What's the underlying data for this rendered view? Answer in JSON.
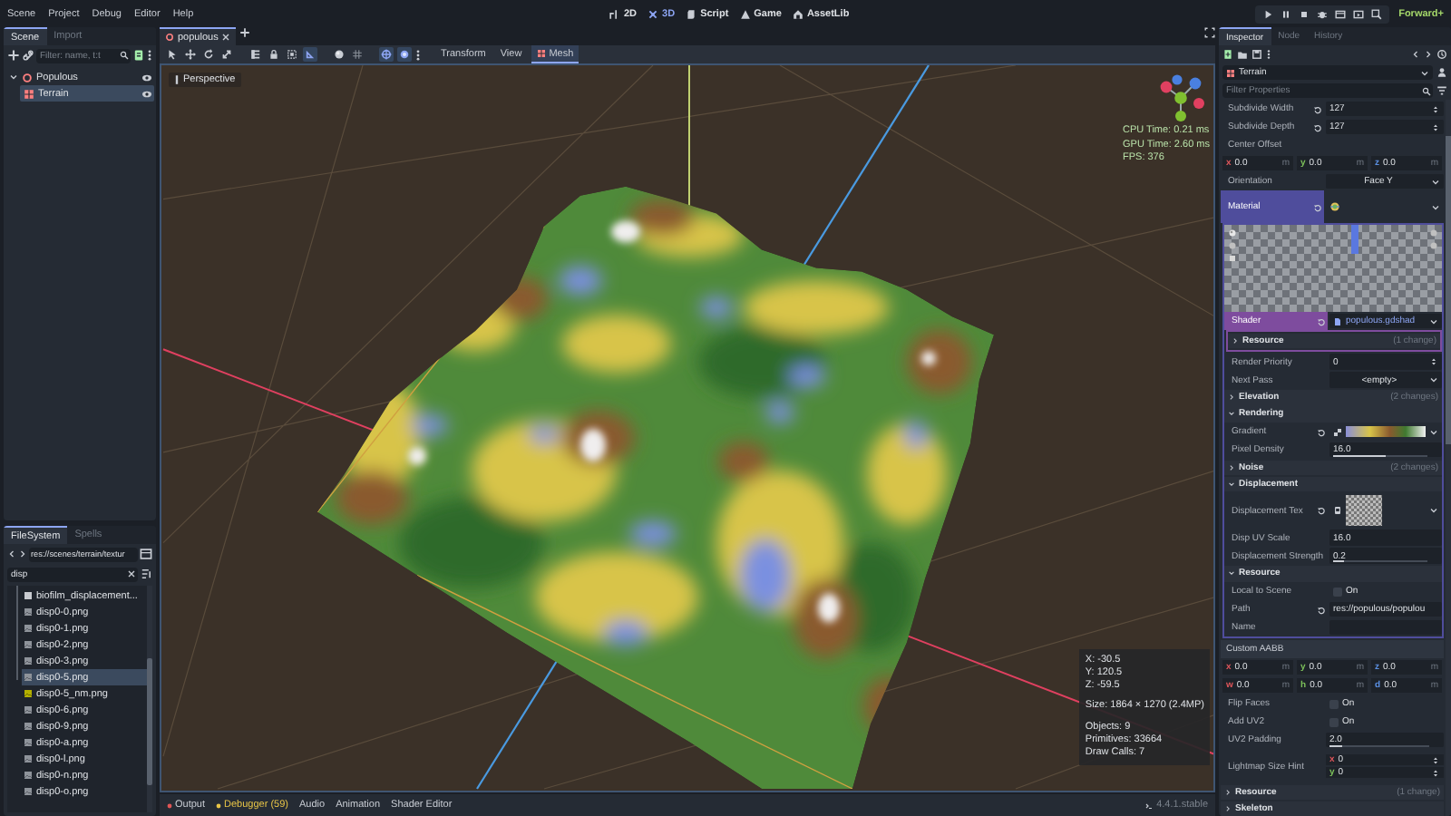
{
  "menu": [
    "Scene",
    "Project",
    "Debug",
    "Editor",
    "Help"
  ],
  "workspaces": [
    {
      "kind": "flat",
      "label": "2D",
      "selected": false
    },
    {
      "kind": "spatial",
      "label": "3D",
      "selected": true
    },
    {
      "kind": "script",
      "label": "Script",
      "selected": false
    },
    {
      "kind": "game",
      "label": "Game",
      "selected": false
    },
    {
      "kind": "assetlib",
      "label": "AssetLib",
      "selected": false
    }
  ],
  "renderer": "Forward+",
  "scene_dock": {
    "tabs": [
      {
        "label": "Scene",
        "selected": true
      },
      {
        "label": "Import",
        "selected": false
      }
    ],
    "filter": {
      "placeholder": "Filter: name, t:t"
    },
    "tree": [
      {
        "label": "Populous",
        "kind": "node3d",
        "selected": false,
        "expanded": true,
        "children": [
          {
            "label": "Terrain",
            "kind": "mesh",
            "selected": true
          }
        ]
      }
    ]
  },
  "filesystem": {
    "tabs": [
      {
        "label": "FileSystem",
        "selected": true
      },
      {
        "label": "Spells",
        "selected": false
      }
    ],
    "path": "res://scenes/terrain/textur",
    "search": {
      "value": "disp"
    },
    "files": [
      {
        "label": "biofilm_displacement...",
        "kind": "plain",
        "selected": false
      },
      {
        "label": "disp0-0.png",
        "kind": "image",
        "selected": false
      },
      {
        "label": "disp0-1.png",
        "kind": "image",
        "selected": false
      },
      {
        "label": "disp0-2.png",
        "kind": "image",
        "selected": false
      },
      {
        "label": "disp0-3.png",
        "kind": "image",
        "selected": false
      },
      {
        "label": "disp0-5.png",
        "kind": "image",
        "selected": true
      },
      {
        "label": "disp0-5_nm.png",
        "kind": "normal",
        "selected": false
      },
      {
        "label": "disp0-6.png",
        "kind": "image",
        "selected": false
      },
      {
        "label": "disp0-9.png",
        "kind": "image",
        "selected": false
      },
      {
        "label": "disp0-a.png",
        "kind": "image",
        "selected": false
      },
      {
        "label": "disp0-l.png",
        "kind": "image",
        "selected": false
      },
      {
        "label": "disp0-n.png",
        "kind": "image",
        "selected": false
      },
      {
        "label": "disp0-o.png",
        "kind": "image",
        "selected": false
      }
    ]
  },
  "editor_tabs": [
    {
      "label": "populous",
      "selected": true
    }
  ],
  "viewport_toolbar": {
    "tools": [
      {
        "kind": "select",
        "selected": false
      },
      {
        "kind": "move",
        "selected": false
      },
      {
        "kind": "rotate",
        "selected": false
      },
      {
        "kind": "scale",
        "selected": false
      },
      {
        "kind": "list",
        "selected": false
      },
      {
        "kind": "lock",
        "selected": false
      },
      {
        "kind": "group",
        "selected": false
      },
      {
        "kind": "ruler",
        "selected": true
      },
      {
        "kind": "sphere",
        "selected": false
      },
      {
        "kind": "grid",
        "selected": false
      },
      {
        "kind": "snap",
        "selected": true
      },
      {
        "kind": "sun",
        "selected": true
      }
    ],
    "menus": [
      {
        "label": "Transform",
        "selected": false
      },
      {
        "label": "View",
        "selected": false
      },
      {
        "label": "Mesh",
        "selected": true
      }
    ]
  },
  "viewport": {
    "camera": "Perspective",
    "stats": [
      "CPU Time: 0.21 ms",
      "GPU Time: 2.60 ms",
      "FPS: 376"
    ],
    "info": [
      [
        "X: -30.5",
        "Y: 120.5",
        "Z: -59.5"
      ],
      [
        "Size: 1864 × 1270 (2.4MP)"
      ],
      [
        "Objects: 9",
        "Primitives: 33664",
        "Draw Calls: 7"
      ]
    ]
  },
  "bottom_panel": {
    "tabs": [
      {
        "label": "Output",
        "color": "#e05555"
      },
      {
        "label": "Debugger (59)",
        "color": "#e8c547"
      },
      {
        "label": "Audio"
      },
      {
        "label": "Animation"
      },
      {
        "label": "Shader Editor"
      }
    ],
    "version": "4.4.1.stable"
  },
  "inspector": {
    "tabs": [
      {
        "label": "Inspector",
        "selected": true
      },
      {
        "label": "Node",
        "selected": false
      },
      {
        "label": "History",
        "selected": false
      }
    ],
    "object": "Terrain",
    "filter": {
      "placeholder": "Filter Properties"
    },
    "properties": [
      {
        "kind": "spin",
        "label": "Subdivide Width",
        "value": "127",
        "revert": true
      },
      {
        "kind": "spin",
        "label": "Subdivide Depth",
        "value": "127",
        "revert": true
      },
      {
        "kind": "label",
        "label": "Center Offset"
      },
      {
        "kind": "vector",
        "fields": [
          {
            "axis": "x",
            "value": "0.0",
            "unit": "m"
          },
          {
            "axis": "y",
            "value": "0.0",
            "unit": "m"
          },
          {
            "axis": "z",
            "value": "0.0",
            "unit": "m"
          }
        ]
      },
      {
        "kind": "enum",
        "label": "Orientation",
        "value": "Face Y"
      },
      {
        "kind": "resource",
        "label": "Material",
        "revert": true,
        "color": "#4f4d9c",
        "children": [
          {
            "kind": "preview"
          },
          {
            "kind": "resource",
            "label": "Shader",
            "value": "populous.gdshad",
            "revert": true,
            "color": "#7e4c9e",
            "children": [
              {
                "kind": "section",
                "label": "Resource",
                "note": "(1 change)",
                "expanded": false
              }
            ]
          },
          {
            "kind": "spin",
            "label": "Render Priority",
            "value": "0"
          },
          {
            "kind": "enum",
            "label": "Next Pass",
            "value": "<empty>"
          },
          {
            "kind": "section",
            "label": "Elevation",
            "note": "(2 changes)",
            "expanded": false
          },
          {
            "kind": "section",
            "label": "Rendering",
            "expanded": true
          },
          {
            "kind": "gradient",
            "label": "Gradient",
            "revert": true
          },
          {
            "kind": "slider",
            "label": "Pixel Density",
            "value": "16.0",
            "level": 0.55
          },
          {
            "kind": "section",
            "label": "Noise",
            "note": "(2 changes)",
            "expanded": false
          },
          {
            "kind": "section",
            "label": "Displacement",
            "expanded": true
          },
          {
            "kind": "texture",
            "label": "Displacement Tex",
            "revert": true
          },
          {
            "kind": "number",
            "label": "Disp UV Scale",
            "value": "16.0"
          },
          {
            "kind": "slider",
            "label": "Displacement Strength",
            "value": "0.2",
            "level": 0.12
          },
          {
            "kind": "section",
            "label": "Resource",
            "expanded": true
          },
          {
            "kind": "check",
            "label": "Local to Scene",
            "text": "On",
            "checked": false
          },
          {
            "kind": "text",
            "label": "Path",
            "value": "res://populous/populou",
            "revert": true
          },
          {
            "kind": "text",
            "label": "Name"
          }
        ]
      },
      {
        "kind": "header",
        "label": "Custom AABB"
      },
      {
        "kind": "vector",
        "fields": [
          {
            "axis": "x",
            "value": "0.0",
            "unit": "m"
          },
          {
            "axis": "y",
            "value": "0.0",
            "unit": "m"
          },
          {
            "axis": "z",
            "value": "0.0",
            "unit": "m"
          }
        ]
      },
      {
        "kind": "vector",
        "fields": [
          {
            "axis": "w",
            "value": "0.0",
            "unit": "m"
          },
          {
            "axis": "h",
            "value": "0.0",
            "unit": "m"
          },
          {
            "axis": "d",
            "value": "0.0",
            "unit": "m"
          }
        ]
      },
      {
        "kind": "check",
        "label": "Flip Faces",
        "text": "On",
        "checked": false
      },
      {
        "kind": "check",
        "label": "Add UV2",
        "text": "On",
        "checked": false
      },
      {
        "kind": "slider",
        "label": "UV2 Padding",
        "value": "2.0",
        "level": 0.12
      },
      {
        "kind": "vector2",
        "label": "Lightmap Size Hint",
        "fields": [
          {
            "axis": "x",
            "value": "0"
          },
          {
            "axis": "y",
            "value": "0"
          }
        ]
      },
      {
        "kind": "section",
        "label": "Resource",
        "note": "(1 change)",
        "expanded": false
      },
      {
        "kind": "section",
        "label": "Skeleton",
        "expanded": false
      }
    ]
  }
}
